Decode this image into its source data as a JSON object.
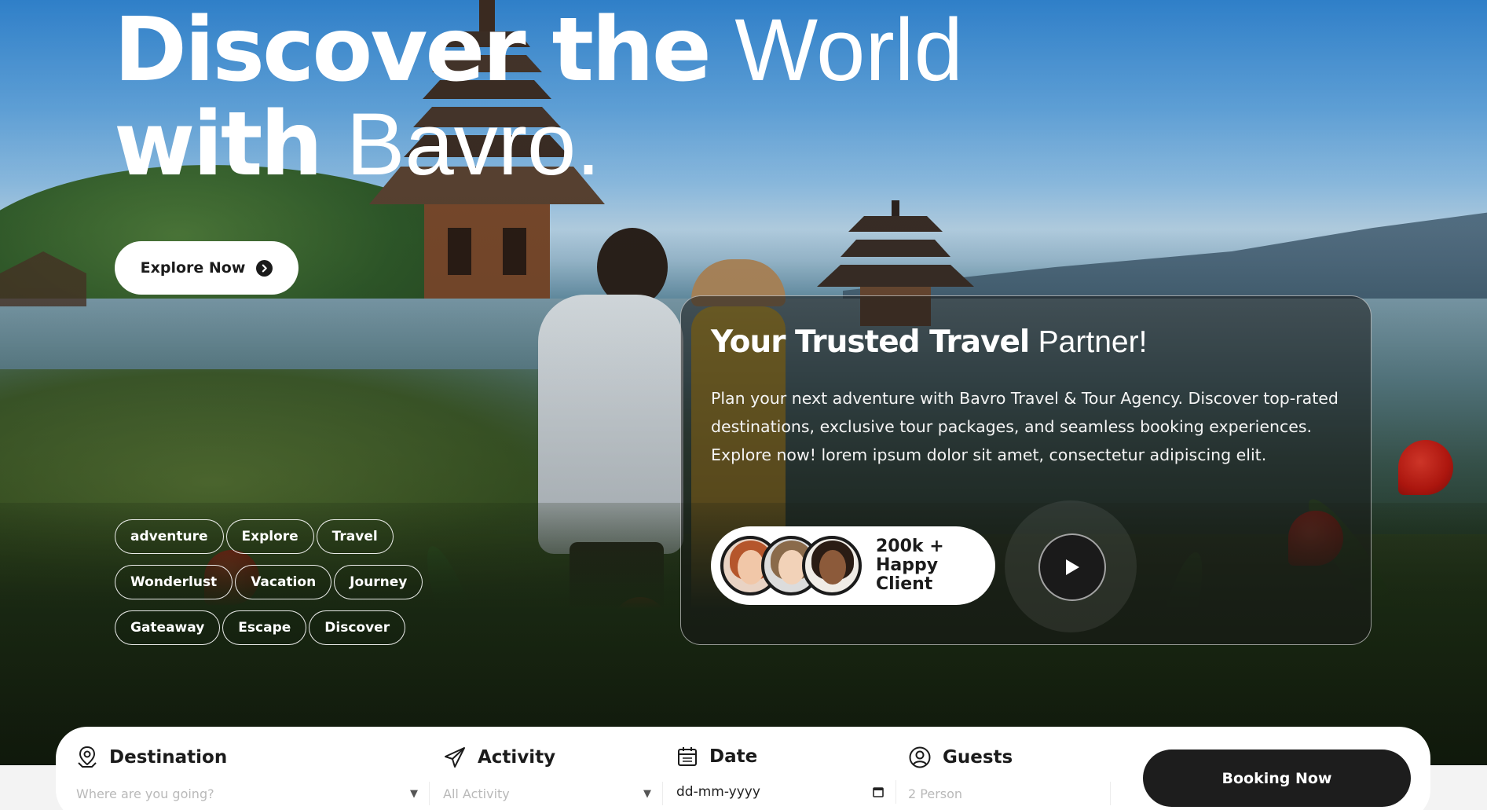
{
  "hero": {
    "headline": {
      "line1_bold": "Discover the",
      "line1_thin": "World",
      "line2_bold": "with",
      "line2_thin": "Bavro."
    },
    "explore_button": {
      "label": "Explore Now",
      "icon": "arrow-right-circle-icon"
    },
    "tags": [
      [
        "adventure",
        "Explore",
        "Travel"
      ],
      [
        "Wonderlust",
        "Vacation",
        "Journey"
      ],
      [
        "Gateaway",
        "Escape",
        "Discover"
      ]
    ]
  },
  "card": {
    "title_bold": "Your Trusted Travel",
    "title_thin": "Partner!",
    "description": "Plan your next adventure with Bavro Travel & Tour Agency. Discover top-rated destinations, exclusive tour packages, and seamless booking experiences. Explore now! lorem ipsum dolor sit amet, consectetur adipiscing elit.",
    "clients": {
      "count": "200k +",
      "label": "Happy Client"
    },
    "play_button": {
      "icon": "play-icon"
    }
  },
  "booking": {
    "destination": {
      "label": "Destination",
      "icon": "map-pin-icon",
      "placeholder": "Where are you going?"
    },
    "activity": {
      "label": "Activity",
      "icon": "paper-plane-icon",
      "placeholder": "All Activity"
    },
    "date": {
      "label": "Date",
      "icon": "calendar-icon",
      "value": "dd-mm-yyyy"
    },
    "guests": {
      "label": "Guests",
      "icon": "user-circle-icon",
      "placeholder": "2 Person"
    },
    "button": "Booking Now"
  },
  "colors": {
    "dark": "#1b1b1b",
    "white": "#ffffff",
    "muted": "#b9b9b9"
  }
}
